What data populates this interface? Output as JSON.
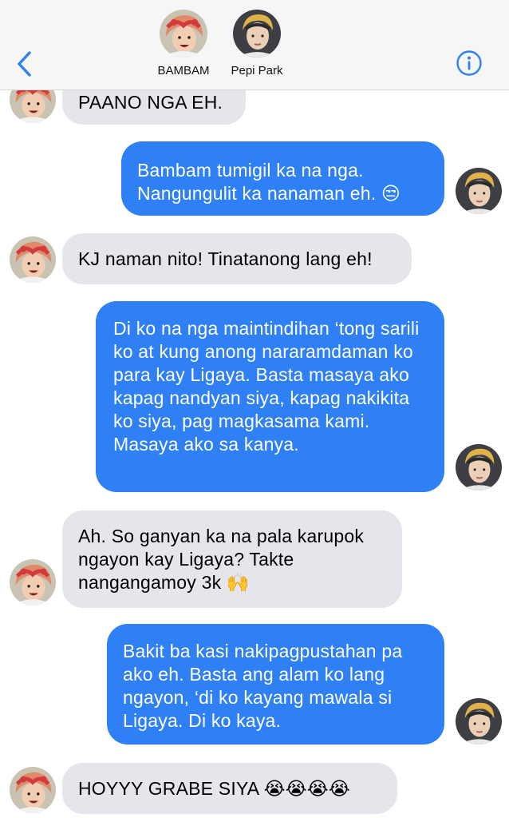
{
  "header": {
    "back_icon": "chevron-left-icon",
    "info_icon": "info-circle-icon",
    "accent": "#2f80f4",
    "contacts": [
      {
        "name": "BAMBAM",
        "avatar": "bambam-avatar"
      },
      {
        "name": "Pepi Park",
        "avatar": "pepi-park-avatar"
      }
    ]
  },
  "colors": {
    "incoming_bubble": "#e6e5eb",
    "outgoing_bubble": "#2f80f4",
    "header_bg": "#f6f6f6"
  },
  "messages": [
    {
      "sender": "BAMBAM",
      "text": "PAANO NGA EH."
    },
    {
      "sender": "Pepi Park",
      "text": "Bambam tumigil ka na nga. Nangungulit ka nanaman eh. 😒"
    },
    {
      "sender": "BAMBAM",
      "text": "KJ naman nito! Tinatanong lang eh!"
    },
    {
      "sender": "Pepi Park",
      "text": "Di ko na nga maintindihan ‘tong sarili ko at kung anong nararamdaman ko para kay Ligaya. Basta masaya ako kapag nandyan siya, kapag nakikita ko siya, pag magkasama kami. Masaya ako sa kanya."
    },
    {
      "sender": "BAMBAM",
      "text": "Ah. So ganyan ka na pala karupok ngayon kay Ligaya? Takte nangangamoy 3k 🙌"
    },
    {
      "sender": "Pepi Park",
      "text": "Bakit ba kasi nakipagpustahan pa ako eh. Basta ang alam ko lang ngayon, ‘di ko kayang mawala si Ligaya. Di ko kaya."
    },
    {
      "sender": "BAMBAM",
      "text": "HOYYY GRABE SIYA 😭😭😭😭"
    }
  ]
}
